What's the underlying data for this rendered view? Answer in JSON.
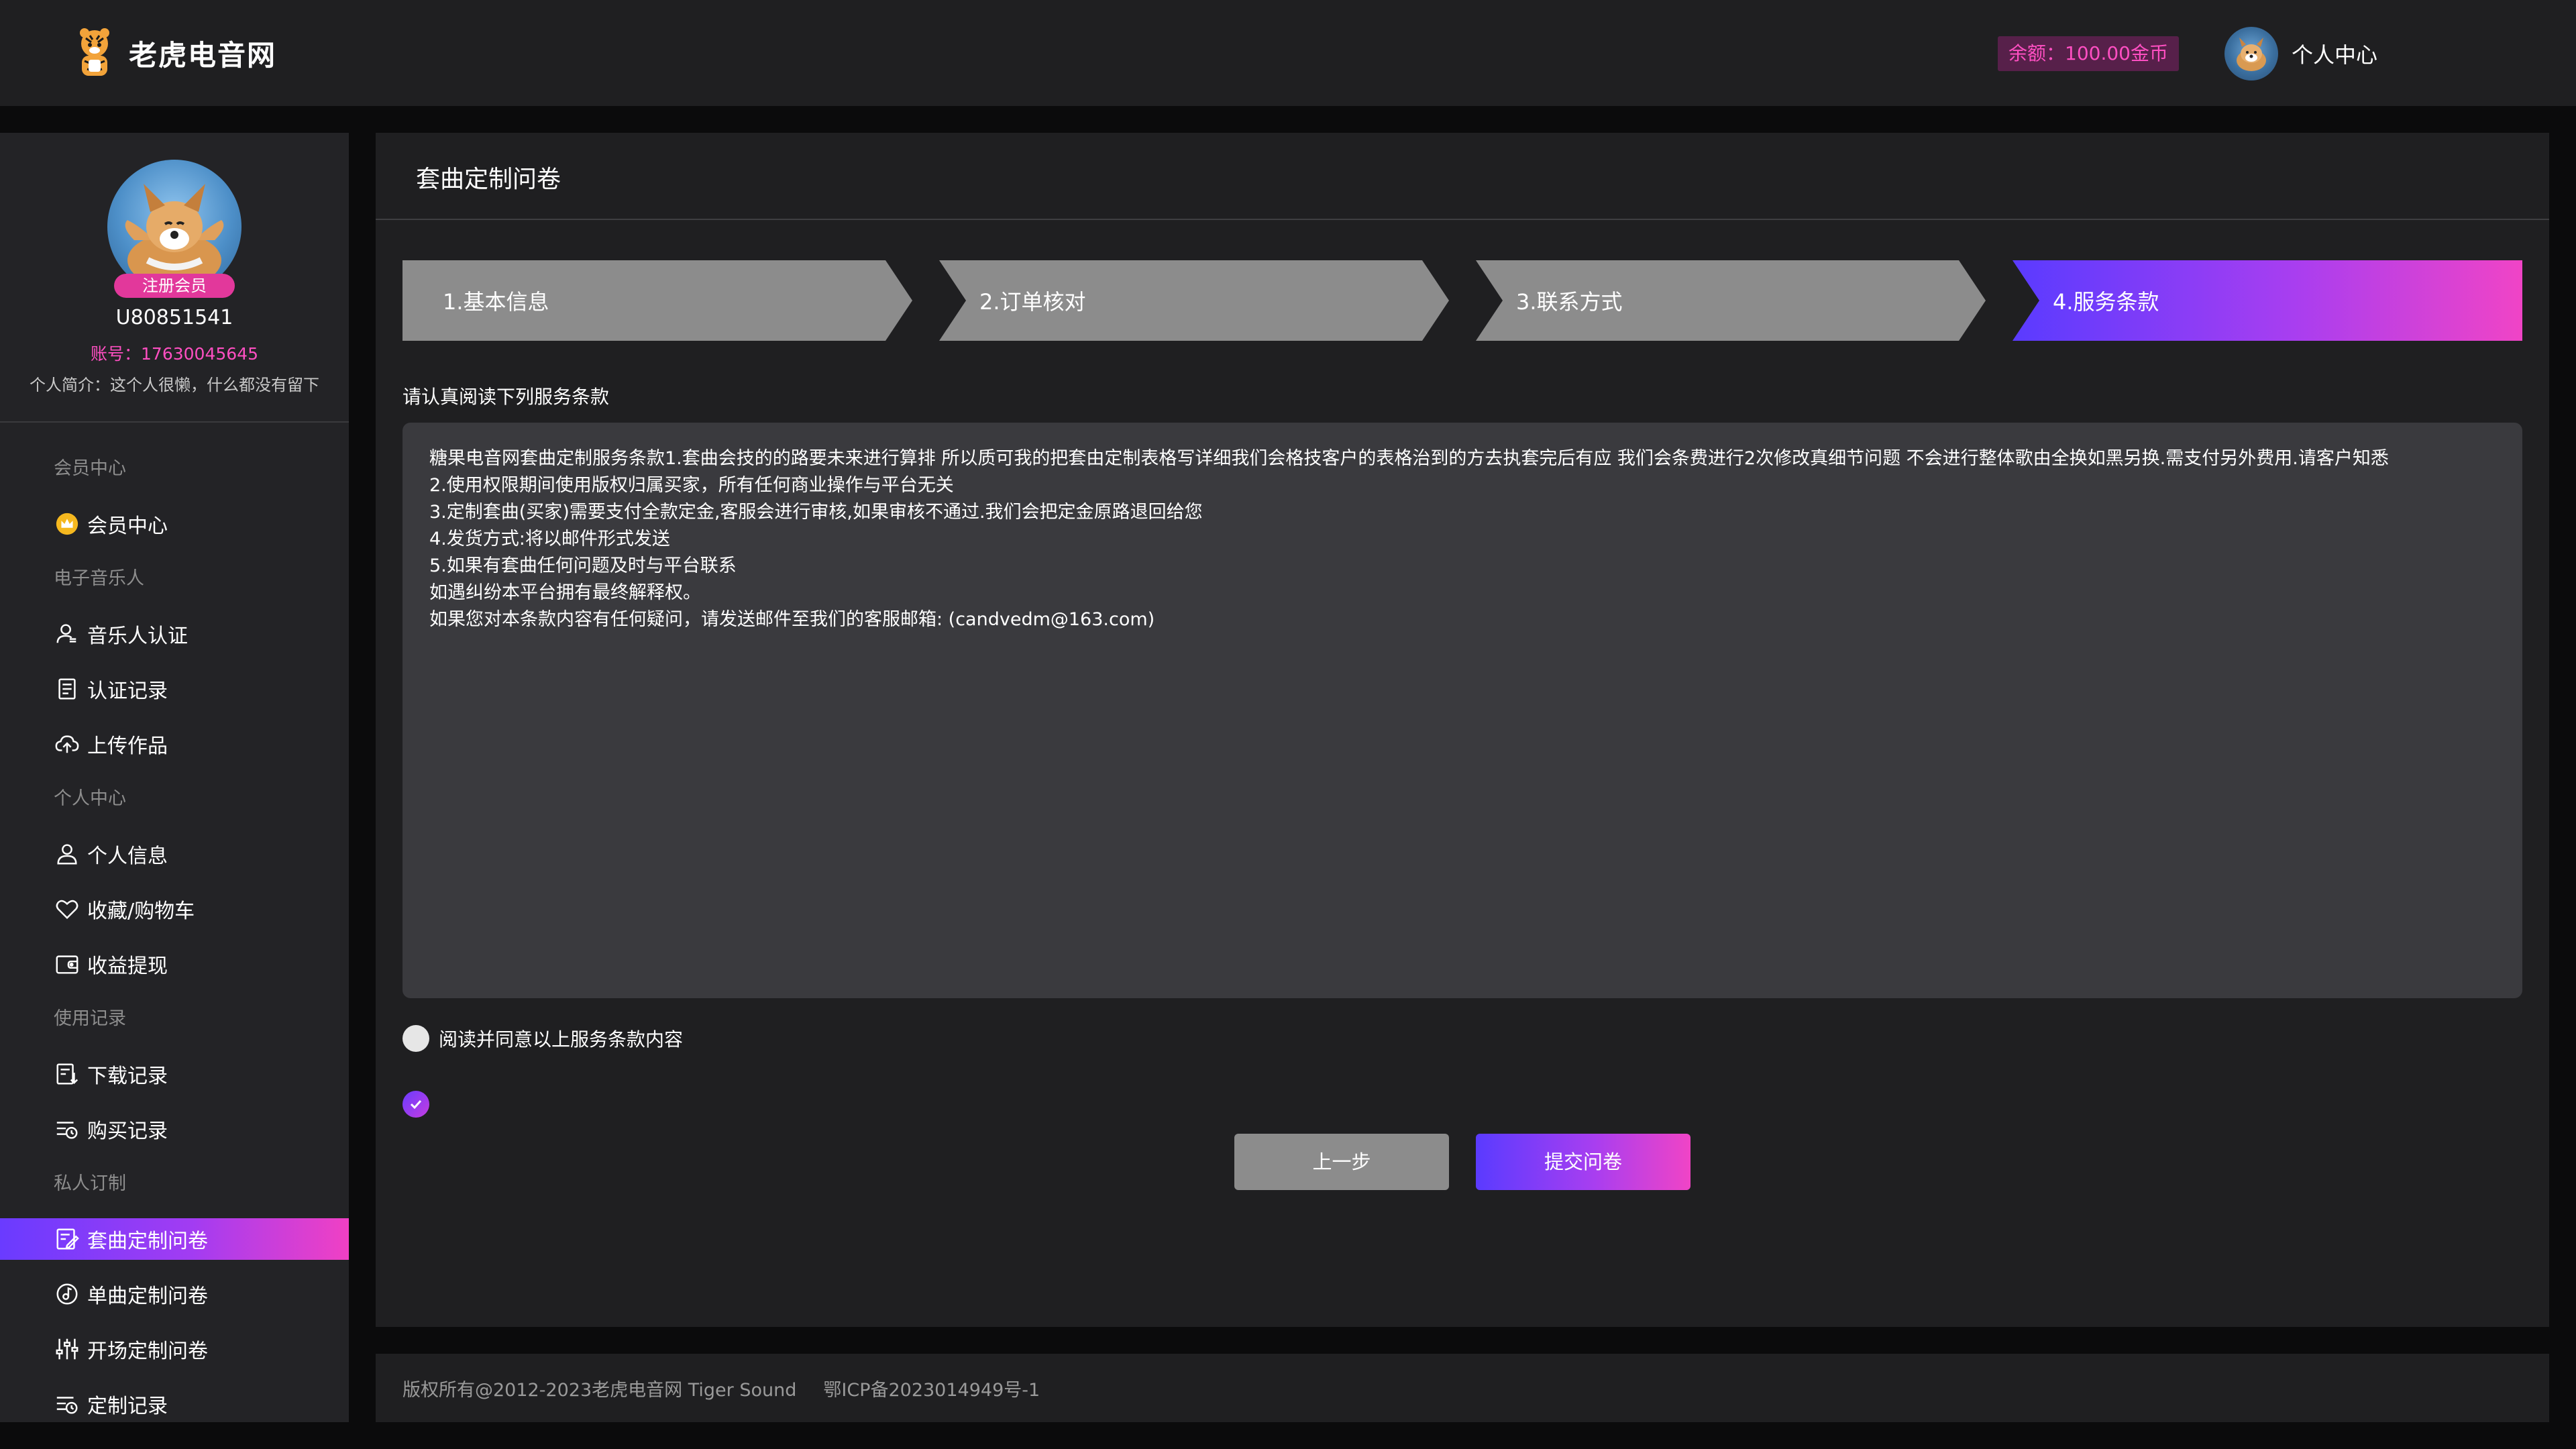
{
  "header": {
    "logo_text": "老虎电音网",
    "balance": "余额：100.00金币",
    "user_center": "个人中心"
  },
  "sidebar": {
    "profile": {
      "badge": "注册会员",
      "username": "U80851541",
      "account": "账号：17630045645",
      "intro": "个人简介：这个人很懒，什么都没有留下"
    },
    "nav": [
      {
        "type": "group",
        "label": "会员中心"
      },
      {
        "type": "item",
        "label": "会员中心",
        "icon": "crown-icon"
      },
      {
        "type": "group",
        "label": "电子音乐人"
      },
      {
        "type": "item",
        "label": "音乐人认证",
        "icon": "user-verify-icon"
      },
      {
        "type": "item",
        "label": "认证记录",
        "icon": "document-icon"
      },
      {
        "type": "item",
        "label": "上传作品",
        "icon": "cloud-upload-icon"
      },
      {
        "type": "group",
        "label": "个人中心"
      },
      {
        "type": "item",
        "label": "个人信息",
        "icon": "user-icon"
      },
      {
        "type": "item",
        "label": "收藏/购物车",
        "icon": "heart-icon"
      },
      {
        "type": "item",
        "label": "收益提现",
        "icon": "wallet-icon"
      },
      {
        "type": "group",
        "label": "使用记录"
      },
      {
        "type": "item",
        "label": "下载记录",
        "icon": "download-list-icon"
      },
      {
        "type": "item",
        "label": "购买记录",
        "icon": "purchase-list-icon"
      },
      {
        "type": "group",
        "label": "私人订制"
      },
      {
        "type": "item",
        "label": "套曲定制问卷",
        "icon": "edit-form-icon",
        "active": true
      },
      {
        "type": "item",
        "label": "单曲定制问卷",
        "icon": "music-disc-icon"
      },
      {
        "type": "item",
        "label": "开场定制问卷",
        "icon": "equalizer-icon"
      },
      {
        "type": "item",
        "label": "定制记录",
        "icon": "record-list-icon"
      }
    ]
  },
  "main": {
    "title": "套曲定制问卷",
    "steps": [
      {
        "label": "1.基本信息",
        "state": "done"
      },
      {
        "label": "2.订单核对",
        "state": "done"
      },
      {
        "label": "3.联系方式",
        "state": "done"
      },
      {
        "label": "4.服务条款",
        "state": "current"
      }
    ],
    "terms_heading": "请认真阅读下列服务条款",
    "terms_lines": [
      "糖果电音网套曲定制服务条款1.套曲会技的的路要未来进行算排 所以质可我的把套由定制表格写详细我们会格技客户的表格治到的方去执套完后有应 我们会条费进行2次修改真细节问题 不会进行整体歌由全换如黑另换.需支付另外费用.请客户知悉",
      "2.使用权限期间使用版权归属买家，所有任何商业操作与平台无关",
      "3.定制套曲(买家)需要支付全款定金,客服会进行审核,如果审核不通过.我们会把定金原路退回给您",
      "4.发货方式:将以邮件形式发送",
      "5.如果有套曲任何问题及时与平台联系",
      "如遇纠纷本平台拥有最终解释权。",
      "如果您对本条款内容有任何疑问，请发送邮件至我们的客服邮箱: (candvedm@163.com)"
    ],
    "agree_label": "阅读并同意以上服务条款内容",
    "agree_checked": false,
    "buttons": {
      "prev": "上一步",
      "submit": "提交问卷"
    }
  },
  "footer": {
    "copyright": "版权所有@2012-2023老虎电音网 Tiger Sound",
    "icp": "鄂ICP备2023014949号-1"
  },
  "colors": {
    "accent_gradient": [
      "#5a3bff",
      "#f044c6"
    ],
    "balance_text": "#ff4fc2",
    "step_done": "#8c8c8c"
  }
}
